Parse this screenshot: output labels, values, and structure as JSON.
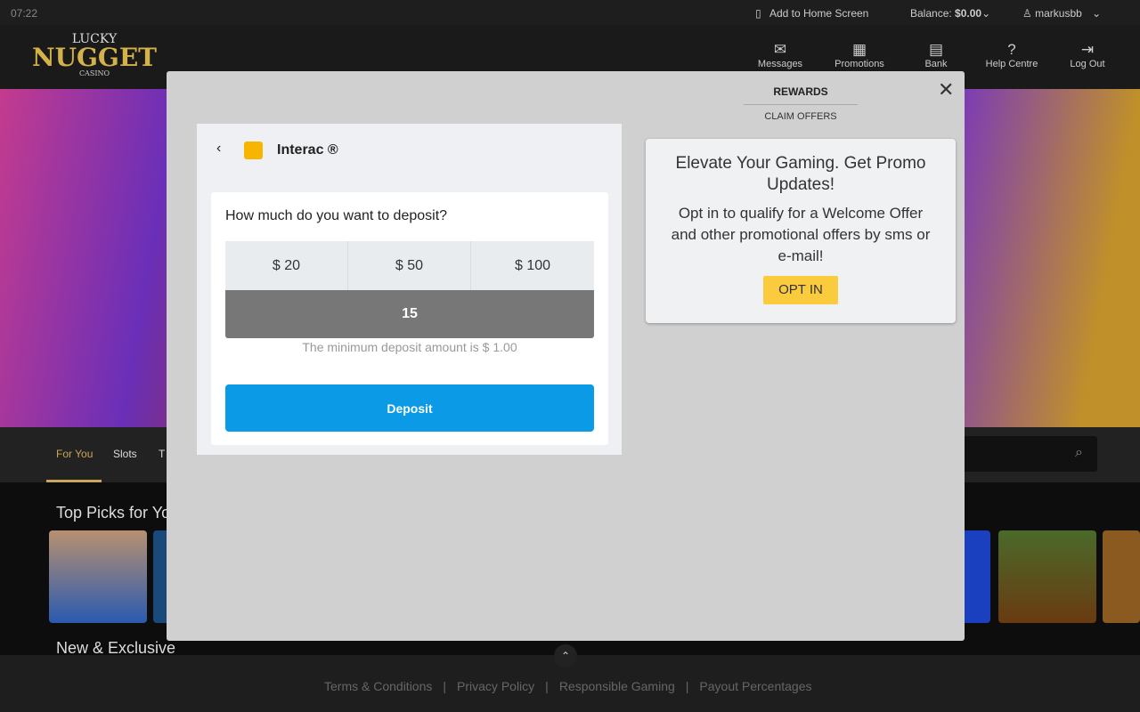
{
  "topbar": {
    "time": "07:22",
    "add_home": "Add to Home Screen",
    "balance_label": "Balance:",
    "balance_value": "$0.00",
    "username": "markusbb"
  },
  "header": {
    "logo": "LUCKY NUGGET CASINO",
    "icons": [
      {
        "label": "Messages",
        "icon": "envelope-icon",
        "g": "✉"
      },
      {
        "label": "Promotions",
        "icon": "calendar-icon",
        "g": "▦"
      },
      {
        "label": "Bank",
        "icon": "bank-icon",
        "g": "▤"
      },
      {
        "label": "Help Centre",
        "icon": "help-icon",
        "g": "?"
      },
      {
        "label": "Log Out",
        "icon": "logout-icon",
        "g": "⇥"
      }
    ]
  },
  "nav": {
    "tabs": [
      "For You",
      "Slots",
      "T"
    ]
  },
  "content": {
    "section1": "Top Picks for Yo",
    "section2": "New & Exclusive"
  },
  "footer": {
    "links": [
      "Terms & Conditions",
      "Privacy Policy",
      "Responsible Gaming",
      "Payout Percentages"
    ]
  },
  "modal": {
    "tabs": {
      "rewards": "REWARDS",
      "claim": "CLAIM OFFERS"
    },
    "payment": {
      "method": "Interac ®",
      "question": "How much do you want to deposit?",
      "amounts": [
        "$ 20",
        "$ 50",
        "$ 100"
      ],
      "value": "15",
      "min_note": "The minimum deposit amount is $ 1.00",
      "deposit": "Deposit"
    },
    "promo": {
      "title": "Elevate Your Gaming. Get Promo Updates!",
      "body": "Opt in to qualify for a Welcome Offer and other promotional offers by sms or e-mail!",
      "button": "OPT IN"
    }
  },
  "colors": {
    "accent_gold": "#c8a65a",
    "deposit_blue": "#0a9ae6",
    "opt_in": "#fbcb3e"
  }
}
